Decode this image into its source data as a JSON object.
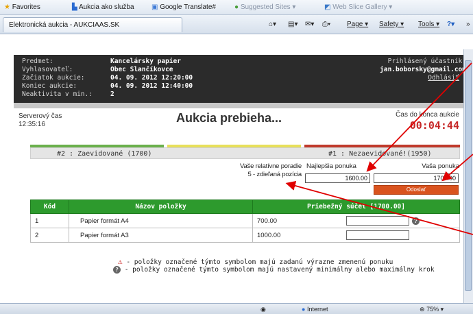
{
  "favorites_bar": {
    "favorites": "Favorites",
    "items": [
      "Aukcia ako služba",
      "Google Translate#",
      "Suggested Sites ▾",
      "Web Slice Gallery ▾"
    ]
  },
  "tab": {
    "title": "Elektronická aukcia - AUKCIAAS.SK"
  },
  "toolbar": {
    "page": "Page ▾",
    "safety": "Safety ▾",
    "tools": "Tools ▾"
  },
  "header": {
    "labels": [
      "Predmet:",
      "Vyhlasovateľ:",
      "Začiatok aukcie:",
      "Koniec aukcie:",
      "Neaktivita v min.:"
    ],
    "values": [
      "Kancelársky papier",
      "Obec Slančíkovce",
      "04. 09. 2012 12:20:00",
      "04. 09. 2012 12:40:00",
      "2"
    ],
    "user_label": "Prihlásený účastník:",
    "user_email": "jan.boborsky@gmail.com",
    "logout": "Odhlásiť"
  },
  "auction": {
    "server_time_label": "Serverový čas",
    "server_time": "12:35:16",
    "title": "Aukcia prebieha...",
    "time_left_label": "Čas do konca aukcie",
    "time_left": "00:04:44",
    "rank_left": "#2 : Zaevidované (1700)",
    "rank_right": "#1 : Nezaevidované!(1950)",
    "colors": {
      "green": "#6ab04c",
      "yellow": "#e8e05a",
      "red": "#c0392b"
    },
    "relative_label": "Vaše relatívne poradie",
    "relative_value": "5 - zdieľaná pozícia",
    "best_label": "Najlepšia ponuka",
    "best_value": "1600.00",
    "your_label": "Vaša ponuka",
    "your_value": "1700.00",
    "send": "Odoslať"
  },
  "table": {
    "headers": [
      "Kód",
      "Názov položky",
      "Priebežný súčet [1700.00]"
    ],
    "rows": [
      {
        "code": "1",
        "name": "Papier formát A4",
        "value": "700.00"
      },
      {
        "code": "2",
        "name": "Papier formát A3",
        "value": "1000.00"
      }
    ]
  },
  "legend": {
    "warn": "- položky označené týmto symbolom majú zadanú výrazne zmenenú ponuku",
    "info": "- položky označené týmto symbolom majú nastavený minimálny alebo maximálny krok"
  },
  "status": {
    "zone": "Internet",
    "zoom": "75%"
  }
}
